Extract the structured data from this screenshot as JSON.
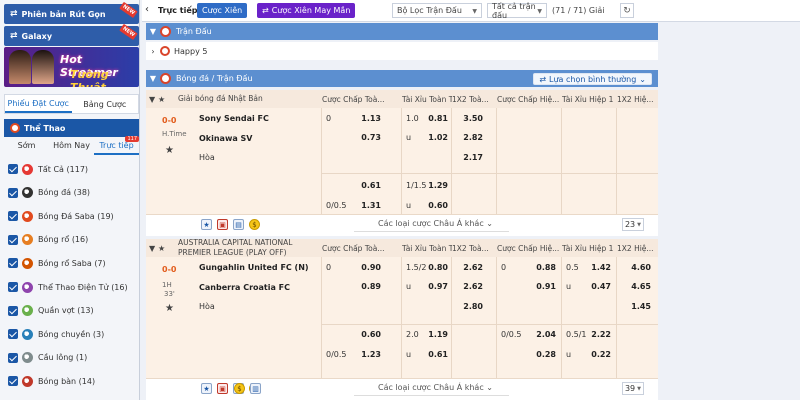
{
  "left": {
    "promo1": "Phiên bản Rút Gọn",
    "promo1_badge": "NEW",
    "promo2": "Galaxy",
    "promo2_badge": "NEW",
    "banner_line1": "Hot Streamer",
    "banner_line2": "Tường Thuật",
    "tabs": [
      "Phiếu Đặt Cược",
      "Bảng Cược"
    ],
    "sport_header": "Thể Thao",
    "subtabs": [
      "Sớm",
      "Hôm Nay",
      "Trực tiếp"
    ],
    "live_count": "117",
    "sports": [
      {
        "label": "Tất Cả",
        "count": "(117)"
      },
      {
        "label": "Bóng đá",
        "count": "(38)"
      },
      {
        "label": "Bóng Đá Saba",
        "count": "(19)"
      },
      {
        "label": "Bóng rổ",
        "count": "(16)"
      },
      {
        "label": "Bóng rổ Saba",
        "count": "(7)"
      },
      {
        "label": "Thể Thao Điện Tử",
        "count": "(16)"
      },
      {
        "label": "Quần vợt",
        "count": "(13)"
      },
      {
        "label": "Bóng chuyền",
        "count": "(3)"
      },
      {
        "label": "Cầu lông",
        "count": "(1)"
      },
      {
        "label": "Bóng bàn",
        "count": "(14)"
      }
    ]
  },
  "topbar": {
    "title": "Trực tiếp",
    "btn_cuoc_xien": "Cược Xiên",
    "btn_cuoc_xien_may_man": "Cược Xiên May Mắn",
    "filter_match": "Bộ Lọc Trận Đấu",
    "filter_all": "Tất cả trận đấu",
    "count": "(71 / 71) Giải"
  },
  "sections": {
    "tran_dau": "Trận Đấu",
    "happy5": "Happy 5",
    "bong_da": "Bóng đá / Trận Đấu",
    "select_btn": "Lựa chọn bình thường"
  },
  "headers": [
    "Cược Chấp Toà...",
    "Tài Xỉu Toàn Trận",
    "1X2 Toà...",
    "Cược Chấp Hiệ...",
    "Tài Xỉu Hiệp 1",
    "1X2 Hiệ..."
  ],
  "match1": {
    "league": "Giải bóng đá Nhật Bản",
    "score": "0-0",
    "time1": "H.Time",
    "time2": "",
    "home": "Sony Sendai FC",
    "away": "Okinawa SV",
    "draw": "Hòa",
    "rows": [
      {
        "c1a": "0",
        "c1b": "1.13",
        "c2a": "1.0",
        "c2b": "0.81",
        "c3": "3.50",
        "c4a": "",
        "c4b": "",
        "c5a": "",
        "c5b": "",
        "c6": ""
      },
      {
        "c1a": "",
        "c1b": "0.73",
        "c2a": "u",
        "c2b": "1.02",
        "c3": "2.82",
        "c4a": "",
        "c4b": "",
        "c5a": "",
        "c5b": "",
        "c6": ""
      },
      {
        "c1a": "",
        "c1b": "",
        "c2a": "",
        "c2b": "",
        "c3": "2.17",
        "c4a": "",
        "c4b": "",
        "c5a": "",
        "c5b": "",
        "c6": ""
      },
      {
        "c1a": "",
        "c1b": "0.61",
        "c2a": "1/1.5",
        "c2b": "1.29",
        "c3": "",
        "c4a": "",
        "c4b": "",
        "c5a": "",
        "c5b": "",
        "c6": ""
      },
      {
        "c1a": "0/0.5",
        "c1b": "1.31",
        "c2a": "u",
        "c2b": "0.60",
        "c3": "",
        "c4a": "",
        "c4b": "",
        "c5a": "",
        "c5b": "",
        "c6": ""
      }
    ],
    "more": "Các loại cược Châu Á khác",
    "page": "23"
  },
  "match2": {
    "league": "AUSTRALIA CAPITAL NATIONAL PREMIER LEAGUE (PLAY OFF)",
    "score": "0-0",
    "time1": "1H",
    "time2": "33'",
    "home": "Gungahlin United FC (N)",
    "away": "Canberra Croatia FC",
    "draw": "Hòa",
    "rows": [
      {
        "c1a": "0",
        "c1b": "0.90",
        "c2a": "1.5/2",
        "c2b": "0.80",
        "c3": "2.62",
        "c4a": "0",
        "c4b": "0.88",
        "c5a": "0.5",
        "c5b": "1.42",
        "c6": "4.60"
      },
      {
        "c1a": "",
        "c1b": "0.89",
        "c2a": "u",
        "c2b": "0.97",
        "c3": "2.62",
        "c4a": "",
        "c4b": "0.91",
        "c5a": "u",
        "c5b": "0.47",
        "c6": "4.65"
      },
      {
        "c1a": "",
        "c1b": "",
        "c2a": "",
        "c2b": "",
        "c3": "2.80",
        "c4a": "",
        "c4b": "",
        "c5a": "",
        "c5b": "",
        "c6": "1.45"
      },
      {
        "c1a": "",
        "c1b": "0.60",
        "c2a": "2.0",
        "c2b": "1.19",
        "c3": "",
        "c4a": "0/0.5",
        "c4b": "2.04",
        "c5a": "0.5/1",
        "c5b": "2.22",
        "c6": ""
      },
      {
        "c1a": "0/0.5",
        "c1b": "1.23",
        "c2a": "u",
        "c2b": "0.61",
        "c3": "",
        "c4a": "",
        "c4b": "0.28",
        "c5a": "u",
        "c5b": "0.22",
        "c6": ""
      }
    ],
    "more": "Các loại cược Châu Á khác",
    "page": "39"
  }
}
